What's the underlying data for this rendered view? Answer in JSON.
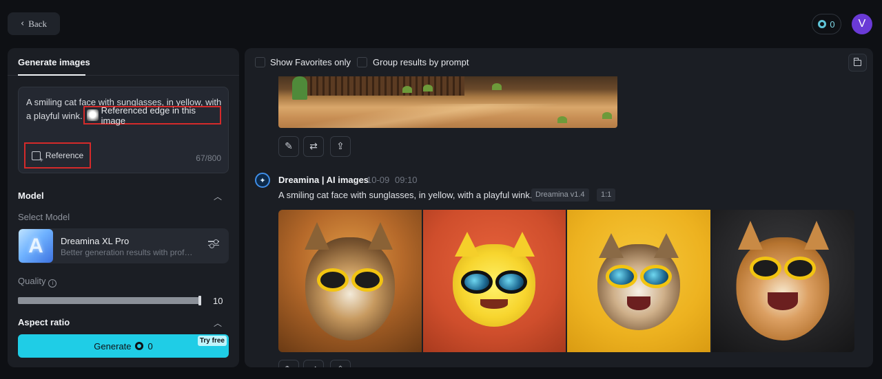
{
  "header": {
    "back_label": "Back",
    "credits": "0",
    "avatar_initial": "V"
  },
  "left_panel": {
    "tab_label": "Generate images",
    "prompt": {
      "text": "A smiling cat face with sunglasses, in yellow, with a playful wink.",
      "reference_chip_label": "Referenced edge in this image",
      "reference_button_label": "Reference",
      "char_count": "67/800"
    },
    "model_section": {
      "title": "Model",
      "select_label": "Select Model",
      "model_name": "Dreamina XL Pro",
      "model_description": "Better generation results with profe...",
      "model_logo_letter": "A"
    },
    "quality": {
      "label": "Quality",
      "value": "10",
      "fraction": 1.0
    },
    "aspect_ratio": {
      "title": "Aspect ratio"
    },
    "generate": {
      "label": "Generate",
      "credits": "0",
      "badge": "Try free"
    }
  },
  "right_panel": {
    "filters": {
      "favorites_label": "Show Favorites only",
      "group_label": "Group results by prompt"
    },
    "result": {
      "author": "Dreamina | AI images",
      "date": "10-09",
      "time": "09:10",
      "prompt": "A smiling cat face with sunglasses, in yellow, with a playful wink.",
      "model_tag": "Dreamina v1.4",
      "ratio_tag": "1:1"
    }
  },
  "colors": {
    "accent": "#1fcde6",
    "avatar": "#6a3ad6",
    "highlight_border": "#d62a2a",
    "panel_bg": "#1b1e24",
    "page_bg": "#0e1014"
  },
  "icons": {
    "back": "chevron-left-icon",
    "credit": "credit-coin-icon",
    "reference": "image-add-icon",
    "collapse": "chevron-up-icon",
    "settings": "sliders-icon",
    "info": "info-icon",
    "folder": "folder-icon",
    "edit": "pencil-icon",
    "regenerate": "repeat-icon",
    "export": "upload-icon",
    "bot": "sparkle-icon"
  }
}
